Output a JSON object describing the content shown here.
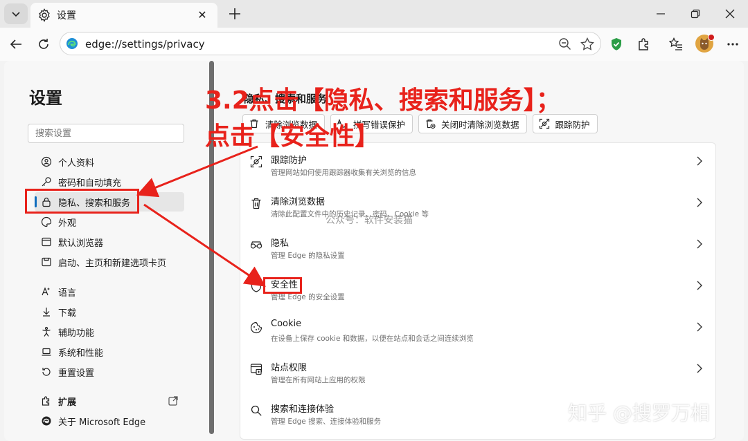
{
  "browser": {
    "tab_title": "设置",
    "url": "edge://settings/privacy"
  },
  "sidebar": {
    "title": "设置",
    "search_placeholder": "搜索设置",
    "items": [
      {
        "label": "个人资料",
        "icon": "profile-icon"
      },
      {
        "label": "密码和自动填充",
        "icon": "key-icon"
      },
      {
        "label": "隐私、搜索和服务",
        "icon": "lock-icon"
      },
      {
        "label": "外观",
        "icon": "palette-icon"
      },
      {
        "label": "默认浏览器",
        "icon": "browser-icon"
      },
      {
        "label": "启动、主页和新建选项卡页",
        "icon": "home-icon"
      },
      {
        "label": "语言",
        "icon": "language-icon"
      },
      {
        "label": "下载",
        "icon": "download-icon"
      },
      {
        "label": "辅助功能",
        "icon": "accessibility-icon"
      },
      {
        "label": "系统和性能",
        "icon": "laptop-icon"
      },
      {
        "label": "重置设置",
        "icon": "reset-icon"
      },
      {
        "label": "扩展",
        "icon": "puzzle-icon"
      },
      {
        "label": "关于 Microsoft Edge",
        "icon": "edge-icon"
      }
    ]
  },
  "main": {
    "heading": "隐私、搜索和服务",
    "quick_buttons": [
      {
        "label": "清除浏览数据",
        "icon": "trash-icon"
      },
      {
        "label": "拼写错误保护",
        "icon": "spellcheck-icon"
      },
      {
        "label": "关闭时清除浏览数据",
        "icon": "close-clear-icon"
      },
      {
        "label": "跟踪防护",
        "icon": "tracking-icon"
      }
    ],
    "rows": [
      {
        "title": "跟踪防护",
        "subtitle": "管理网站如何使用跟踪器收集有关浏览的信息",
        "icon": "tracking-icon"
      },
      {
        "title": "清除浏览数据",
        "subtitle": "清除此配置文件中的历史记录、密码、Cookie 等",
        "icon": "trash-icon"
      },
      {
        "title": "隐私",
        "subtitle": "管理 Edge 的隐私设置",
        "icon": "glasses-icon"
      },
      {
        "title": "安全性",
        "subtitle": "管理 Edge 的安全设置",
        "icon": "shield-icon"
      },
      {
        "title": "Cookie",
        "subtitle": "在设备上保存 cookie 和数据，以便在站点和会话之间连续浏览",
        "icon": "cookie-icon"
      },
      {
        "title": "站点权限",
        "subtitle": "管理在所有网站上应用的权限",
        "icon": "site-permissions-icon"
      },
      {
        "title": "搜索和连接体验",
        "subtitle": "管理 Edge 搜索、连接体验和服务",
        "icon": "search-icon"
      }
    ]
  },
  "annotations": {
    "line1": "3.2点击【隐私、搜索和服务】；",
    "line2": "点击【安全性】",
    "color": "#e8221b"
  },
  "watermarks": {
    "middle": "公众号：软件安装猫",
    "corner": "知乎 @搜罗万相"
  }
}
